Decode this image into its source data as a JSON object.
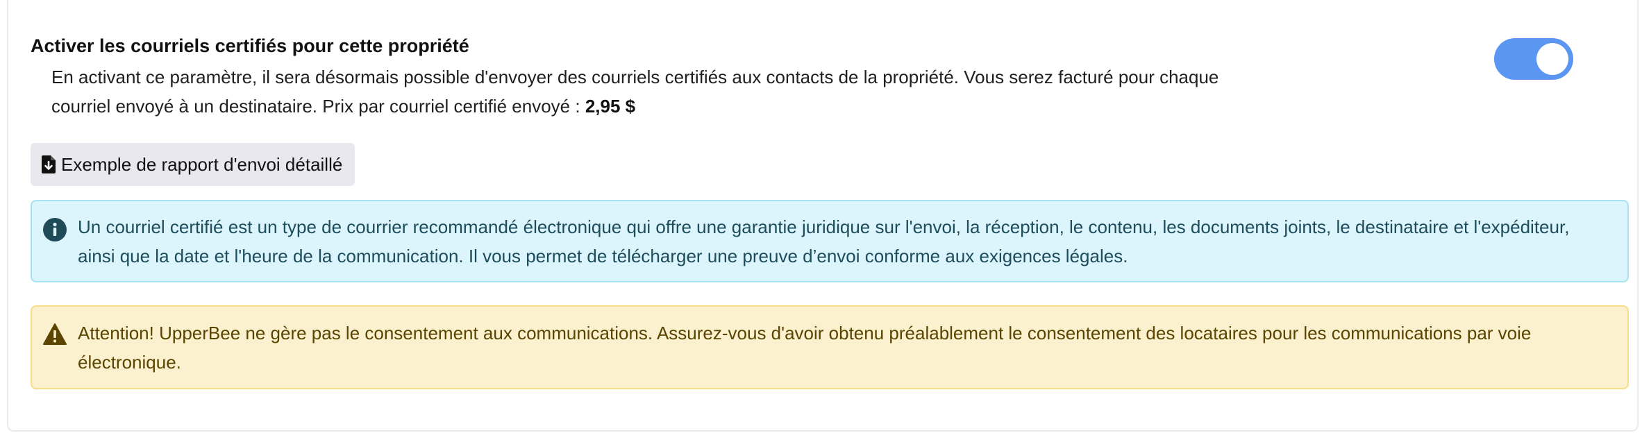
{
  "setting": {
    "title": "Activer les courriels certifiés pour cette propriété",
    "description": "En activant ce paramètre, il sera désormais possible d'envoyer des courriels certifiés aux contacts de la propriété. Vous serez facturé pour chaque courriel envoyé à un destinataire. Prix par courriel certifié envoyé : ",
    "price": "2,95 $",
    "enabled": true
  },
  "report_button": {
    "label": "Exemple de rapport d'envoi détaillé",
    "icon": "file-download-icon"
  },
  "info_alert": {
    "icon": "info-circle-icon",
    "text": "Un courriel certifié est un type de courrier recommandé électronique qui offre une garantie juridique sur l'envoi, la réception, le contenu, les documents joints, le destinataire et l'expéditeur, ainsi que la date et l'heure de la communication. Il vous permet de télécharger une preuve d’envoi conforme aux exigences légales."
  },
  "warning_alert": {
    "icon": "warning-triangle-icon",
    "text": "Attention! UpperBee ne gère pas le consentement aux communications. Assurez-vous d'avoir obtenu préalablement le consentement des locataires pour les communications par voie électronique."
  },
  "colors": {
    "toggle_on": "#5b96f2",
    "info_bg": "#dcf4fb",
    "info_border": "#a8e3f2",
    "warning_bg": "#fbf1cf",
    "warning_border": "#f6dd87"
  }
}
